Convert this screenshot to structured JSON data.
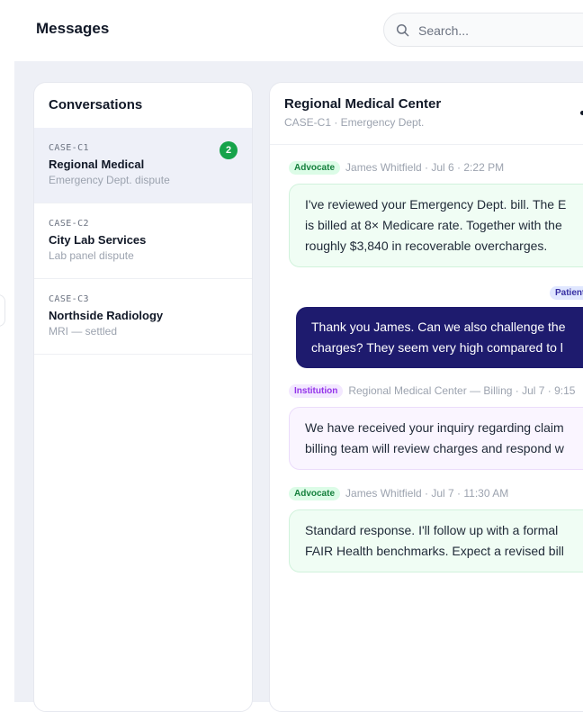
{
  "header": {
    "title": "Messages",
    "search_placeholder": "Search..."
  },
  "conversations": {
    "title": "Conversations",
    "items": [
      {
        "code": "CASE-C1",
        "name": "Regional Medical",
        "subtitle": "Emergency Dept. dispute",
        "badge": "2",
        "active": true
      },
      {
        "code": "CASE-C2",
        "name": "City Lab Services",
        "subtitle": "Lab panel dispute"
      },
      {
        "code": "CASE-C3",
        "name": "Northside Radiology",
        "subtitle": "MRI — settled"
      }
    ]
  },
  "chat": {
    "title": "Regional Medical Center",
    "subtitle": "CASE-C1 · Emergency Dept.",
    "messages": [
      {
        "role_tag": "Advocate",
        "meta": "James Whitfield · Jul 6 · 2:22 PM",
        "lines": [
          "I've reviewed your Emergency Dept. bill. The E",
          "is billed at 8× Medicare rate. Together with the",
          "roughly $3,840 in recoverable overcharges."
        ]
      },
      {
        "role_tag": "Patient",
        "lines": [
          "Thank you James. Can we also challenge the",
          "charges? They seem very high compared to l"
        ]
      },
      {
        "role_tag": "Institution",
        "meta": "Regional Medical Center — Billing · Jul 7 · 9:15",
        "lines": [
          "We have received your inquiry regarding claim",
          "billing team will review charges and respond w"
        ]
      },
      {
        "role_tag": "Advocate",
        "meta": "James Whitfield · Jul 7 · 11:30 AM",
        "lines": [
          "Standard response. I'll follow up with a formal",
          "FAIR Health benchmarks. Expect a revised bill"
        ]
      }
    ]
  },
  "colors": {
    "accent": "#1e1b6e",
    "advocate_tag": "#15803d",
    "institution_tag": "#9333ea",
    "badge": "#16a34a"
  }
}
